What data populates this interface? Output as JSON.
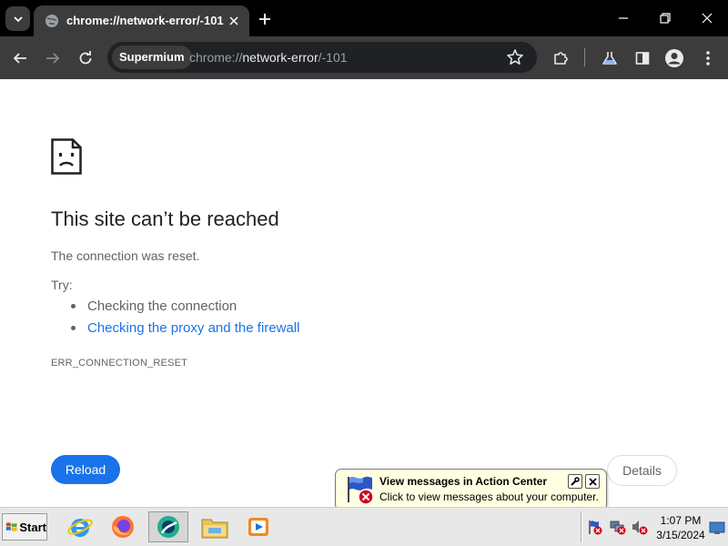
{
  "window": {
    "tab_title": "chrome://network-error/-101",
    "controls": [
      "minimize-icon",
      "restore-icon",
      "close-icon"
    ]
  },
  "toolbar": {
    "chip_label": "Supermium",
    "url_scheme": "chrome://",
    "url_host": "network-error",
    "url_path": "/-101",
    "icons": [
      "back-icon",
      "forward-icon",
      "reload-icon",
      "star-icon",
      "extensions-icon",
      "labs-icon",
      "side-panel-icon",
      "profile-icon",
      "menu-icon"
    ]
  },
  "page": {
    "heading": "This site can’t be reached",
    "subtitle": "The connection was reset.",
    "try_label": "Try:",
    "suggestions": [
      {
        "text": "Checking the connection",
        "link": false
      },
      {
        "text": "Checking the proxy and the firewall",
        "link": true
      }
    ],
    "error_code": "ERR_CONNECTION_RESET",
    "reload_label": "Reload",
    "details_label": "Details"
  },
  "balloon": {
    "title": "View messages in Action Center",
    "text": "Click to view messages about your computer."
  },
  "taskbar": {
    "start_label": "Start",
    "apps": [
      "internet-explorer-icon",
      "firefox-icon",
      "supermium-icon",
      "file-explorer-icon",
      "media-player-icon"
    ],
    "tray": [
      "action-center-flag-icon",
      "network-error-icon",
      "volume-muted-icon"
    ],
    "clock_time": "1:07 PM",
    "clock_date": "3/15/2024"
  },
  "colors": {
    "accent": "#1a73e8",
    "toolbar": "#3c3c3c",
    "tabstrip": "#000000",
    "balloon": "#ffffe1"
  }
}
